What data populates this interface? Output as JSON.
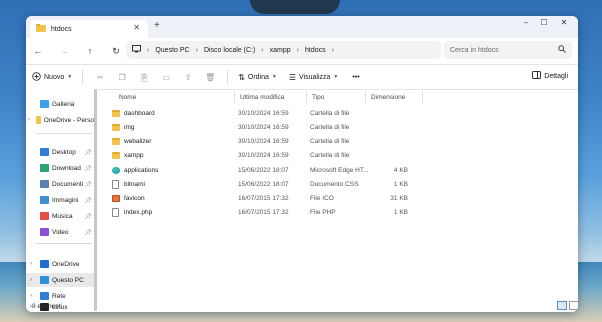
{
  "window": {
    "tab_title": "htdocs",
    "new_tab": "+",
    "minimize": "–",
    "maximize": "☐",
    "close": "✕",
    "tab_close": "✕"
  },
  "nav": {
    "back": "←",
    "forward": "→",
    "up": "↑",
    "refresh": "↻"
  },
  "address": {
    "crumbs": [
      "Questo PC",
      "Disco locale (C:)",
      "xampp",
      "htdocs"
    ],
    "separator": "›"
  },
  "search": {
    "placeholder": "Cerca in htdocs",
    "icon": "search-icon"
  },
  "toolbar": {
    "new_label": "Nuovo",
    "sort_label": "Ordina",
    "view_label": "Visualizza",
    "more": "•••",
    "details_label": "Dettagli"
  },
  "sidebar": {
    "items": [
      {
        "label": "Galleria",
        "icon": "gallery-icon",
        "color": "#3aa0e8"
      },
      {
        "label": "OneDrive - Perso",
        "icon": "onedrive-icon",
        "color": "#f2c24a"
      },
      {
        "label": "Desktop",
        "icon": "desktop-icon",
        "color": "#2b7fd6"
      },
      {
        "label": "Download",
        "icon": "download-icon",
        "color": "#2aa36f"
      },
      {
        "label": "Documenti",
        "icon": "documents-icon",
        "color": "#5a7fb8"
      },
      {
        "label": "Immagini",
        "icon": "pictures-icon",
        "color": "#3a8fd6"
      },
      {
        "label": "Musica",
        "icon": "music-icon",
        "color": "#e0523f"
      },
      {
        "label": "Video",
        "icon": "video-icon",
        "color": "#8a4fd6"
      },
      {
        "label": "OneDrive",
        "icon": "onedrive-icon",
        "color": "#1d6fd1"
      },
      {
        "label": "Questo PC",
        "icon": "pc-icon",
        "color": "#2b8fd6"
      },
      {
        "label": "Rete",
        "icon": "network-icon",
        "color": "#2b7fd6"
      },
      {
        "label": "Linux",
        "icon": "linux-icon",
        "color": "#222222"
      }
    ]
  },
  "columns": {
    "name": "Nome",
    "date": "Ultima modifica",
    "type": "Tipo",
    "size": "Dimensione"
  },
  "files": [
    {
      "name": "dashboard",
      "date": "30/10/2024 16:59",
      "type": "Cartella di file",
      "size": "",
      "icon": "folder-icon"
    },
    {
      "name": "img",
      "date": "30/10/2024 16:59",
      "type": "Cartella di file",
      "size": "",
      "icon": "folder-icon"
    },
    {
      "name": "webalizer",
      "date": "30/10/2024 16:59",
      "type": "Cartella di file",
      "size": "",
      "icon": "folder-icon"
    },
    {
      "name": "xampp",
      "date": "30/10/2024 16:59",
      "type": "Cartella di file",
      "size": "",
      "icon": "folder-icon"
    },
    {
      "name": "applications",
      "date": "15/06/2022 18:07",
      "type": "Microsoft Edge HT...",
      "size": "4 KB",
      "icon": "edge-html-icon"
    },
    {
      "name": "bitnami",
      "date": "15/06/2022 18:07",
      "type": "Documento CSS",
      "size": "1 KB",
      "icon": "css-file-icon"
    },
    {
      "name": "favicon",
      "date": "16/07/2015 17:32",
      "type": "File ICO",
      "size": "31 KB",
      "icon": "ico-file-icon"
    },
    {
      "name": "index.php",
      "date": "16/07/2015 17:32",
      "type": "File PHP",
      "size": "1 KB",
      "icon": "php-file-icon"
    }
  ],
  "status": {
    "count": "8 elementi"
  }
}
